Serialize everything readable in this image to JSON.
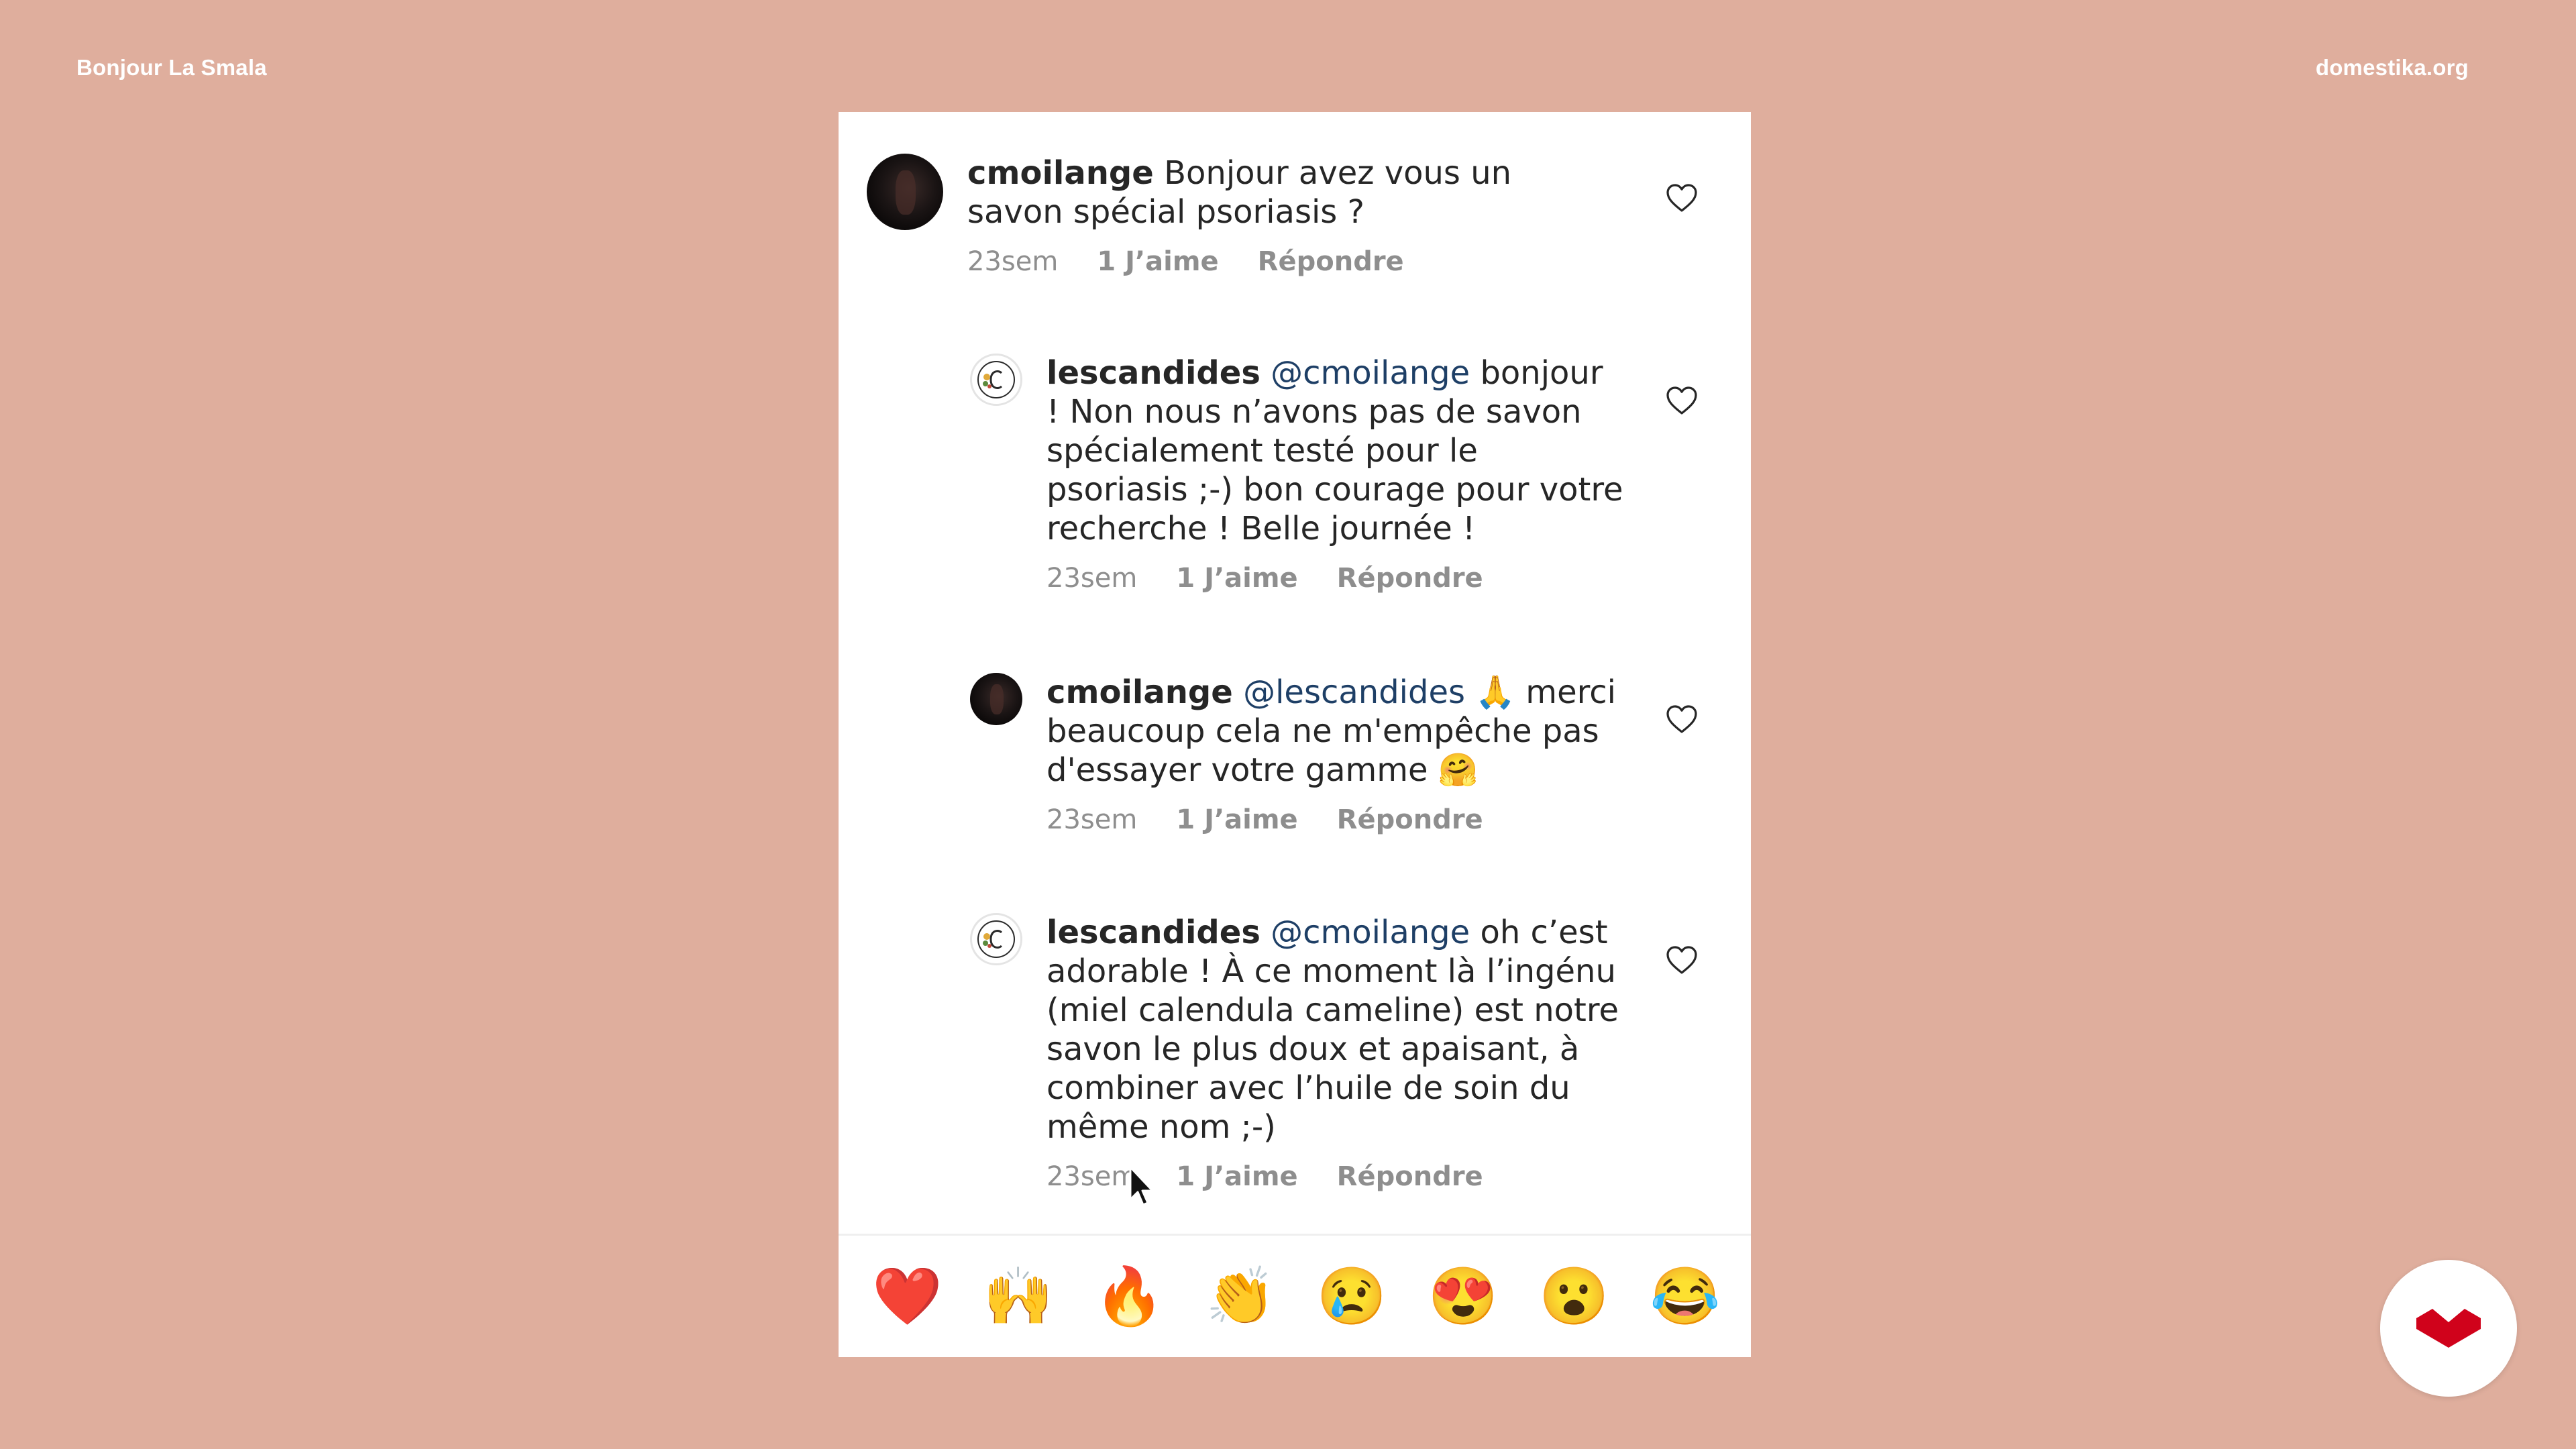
{
  "corner": {
    "left_label": "Bonjour La Smala",
    "right_label": "domestika.org"
  },
  "comments": [
    {
      "username": "cmoilange",
      "mention": "",
      "text": "Bonjour avez vous un savon spécial psoriasis ?",
      "time": "23sem",
      "likes": "1 J’aime",
      "reply": "Répondre",
      "avatar": "dark-portrait"
    },
    {
      "username": "lescandides",
      "mention": "@cmoilange",
      "text": "bonjour ! Non nous n’avons pas de savon spécialement testé pour le psoriasis ;-) bon courage pour votre recherche ! Belle journée !",
      "time": "23sem",
      "likes": "1 J’aime",
      "reply": "Répondre",
      "avatar": "brand-logo"
    },
    {
      "username": "cmoilange",
      "mention": "@lescandides",
      "text": "🙏 merci beaucoup cela ne m'empêche pas d'essayer votre gamme 🤗",
      "time": "23sem",
      "likes": "1 J’aime",
      "reply": "Répondre",
      "avatar": "dark-portrait"
    },
    {
      "username": "lescandides",
      "mention": "@cmoilange",
      "text": "oh c’est adorable ! À ce moment là l’ingénu (miel calendula cameline) est notre savon le plus doux et apaisant, à combiner avec l’huile de soin du même nom ;-)",
      "time": "23sem",
      "likes": "1 J’aime",
      "reply": "Répondre",
      "avatar": "brand-logo"
    }
  ],
  "emoji_bar": [
    "❤️",
    "🙌",
    "🔥",
    "👏",
    "😢",
    "😍",
    "😮",
    "😂"
  ],
  "colors": {
    "background": "#dfae9d",
    "card": "#ffffff",
    "text": "#262626",
    "mention": "#1e3f66",
    "meta": "#8e8e8e",
    "brand_red": "#d0021b"
  },
  "icons": {
    "like": "heart-outline-icon",
    "brand": "domestika-logo-icon",
    "pointer": "mouse-cursor-icon"
  }
}
